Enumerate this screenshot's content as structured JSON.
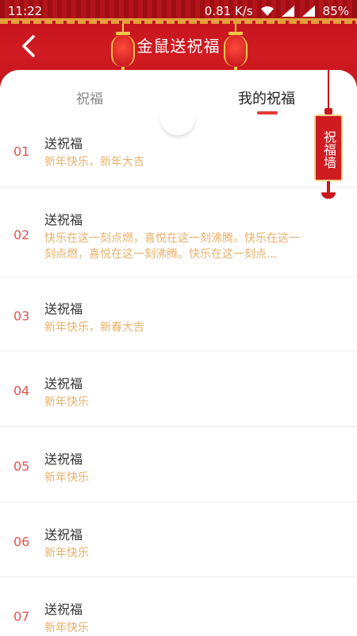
{
  "status_bar": {
    "time": "11:22",
    "network_speed": "0.81 K/s",
    "battery": "85%"
  },
  "header": {
    "title": "金鼠送祝福"
  },
  "tabs": [
    {
      "label": "祝福",
      "active": false
    },
    {
      "label": "我的祝福",
      "active": true
    }
  ],
  "sign": {
    "label": "祝福墙"
  },
  "items": [
    {
      "num": "01",
      "title": "送祝福",
      "subtitle": "新年快乐，新年大吉"
    },
    {
      "num": "02",
      "title": "送祝福",
      "subtitle": "快乐在这一刻点燃，喜悦在这一刻沸腾。快乐在这一刻点燃，喜悦在这一刻沸腾。快乐在这一刻点..."
    },
    {
      "num": "03",
      "title": "送祝福",
      "subtitle": "新年快乐，新春大吉"
    },
    {
      "num": "04",
      "title": "送祝福",
      "subtitle": "新年快乐"
    },
    {
      "num": "05",
      "title": "送祝福",
      "subtitle": "新年快乐"
    },
    {
      "num": "06",
      "title": "送祝福",
      "subtitle": "新年快乐"
    },
    {
      "num": "07",
      "title": "送祝福",
      "subtitle": "新年快乐"
    }
  ],
  "colors": {
    "primary": "#d11a22",
    "accent": "#e8b16b",
    "number": "#e0554e"
  }
}
